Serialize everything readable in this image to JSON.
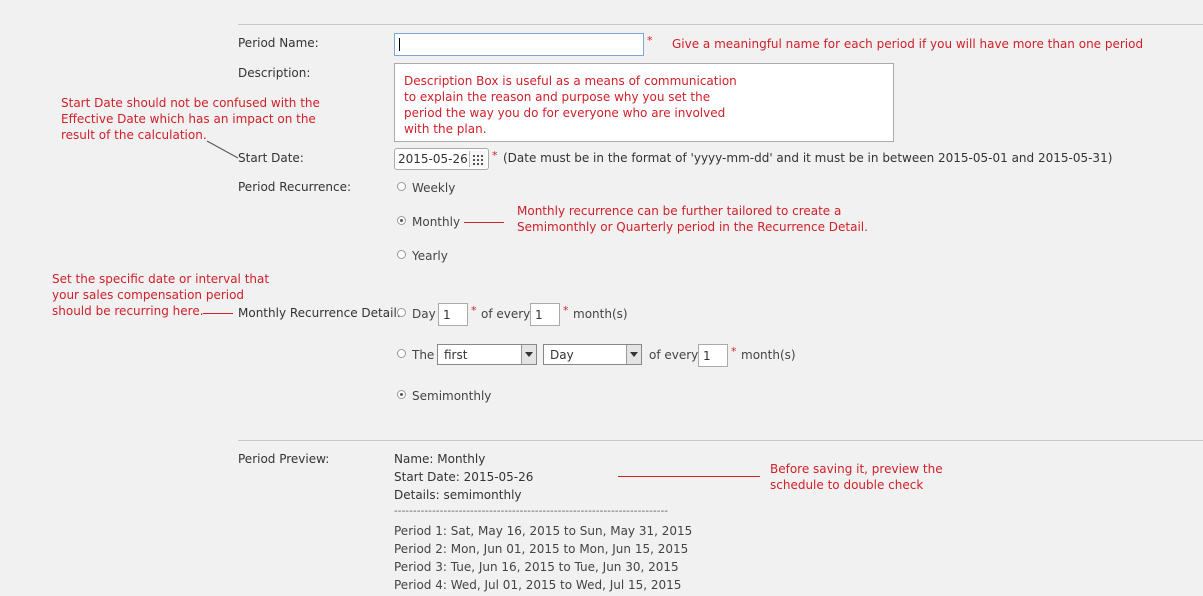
{
  "form": {
    "period_name": {
      "label": "Period Name:",
      "value": "",
      "hint": "Give a meaningful name for each period if you will have more than one period"
    },
    "description": {
      "label": "Description:",
      "text": "Description Box is useful as a means of communication to explain the reason and purpose why you set the period the way you do for everyone who are involved with the plan."
    },
    "start_date": {
      "label": "Start Date:",
      "value": "2015-05-26",
      "note": "(Date must be in the format of 'yyyy-mm-dd' and it must be in between 2015-05-01 and 2015-05-31)"
    },
    "recurrence": {
      "label": "Period Recurrence:",
      "options": [
        {
          "label": "Weekly",
          "selected": false
        },
        {
          "label": "Monthly",
          "selected": true
        },
        {
          "label": "Yearly",
          "selected": false
        }
      ]
    },
    "monthly_detail": {
      "label": "Monthly Recurrence Detail:",
      "day_label": "Day",
      "day_value": "1",
      "of_every": "of every",
      "every_value": "1",
      "months": "month(s)",
      "the_label": "The",
      "the_select": "first",
      "day_select": "Day",
      "of_every2": "of every",
      "every_value2": "1",
      "months2": "month(s)",
      "semimonthly": "Semimonthly"
    },
    "required_mark": "*"
  },
  "preview": {
    "label": "Period Preview:",
    "name": "Name: Monthly",
    "start": "Start Date: 2015-05-26",
    "details": "Details: semimonthly",
    "separator": "------------------------------------------------------------------------",
    "periods": [
      "Period 1: Sat, May 16, 2015 to Sun, May 31, 2015",
      "Period 2: Mon, Jun 01, 2015 to Mon, Jun 15, 2015",
      "Period 3: Tue, Jun 16, 2015 to Tue, Jun 30, 2015",
      "Period 4: Wed, Jul 01, 2015 to Wed, Jul 15, 2015"
    ]
  },
  "annotations": {
    "start_date": [
      "Start Date should not be confused with the",
      "Effective Date which has an impact on the",
      "result of the calculation."
    ],
    "monthly": [
      "Monthly recurrence can be further tailored to create a",
      "Semimonthly or Quarterly period in the Recurrence Detail."
    ],
    "specific": [
      "Set the specific date or interval that",
      "your sales compensation period",
      "should be recurring here."
    ],
    "preview": [
      "Before saving it, preview the",
      "schedule to double check"
    ]
  },
  "colors": {
    "annotation": "#d0202a",
    "background": "#f1f1f1"
  }
}
